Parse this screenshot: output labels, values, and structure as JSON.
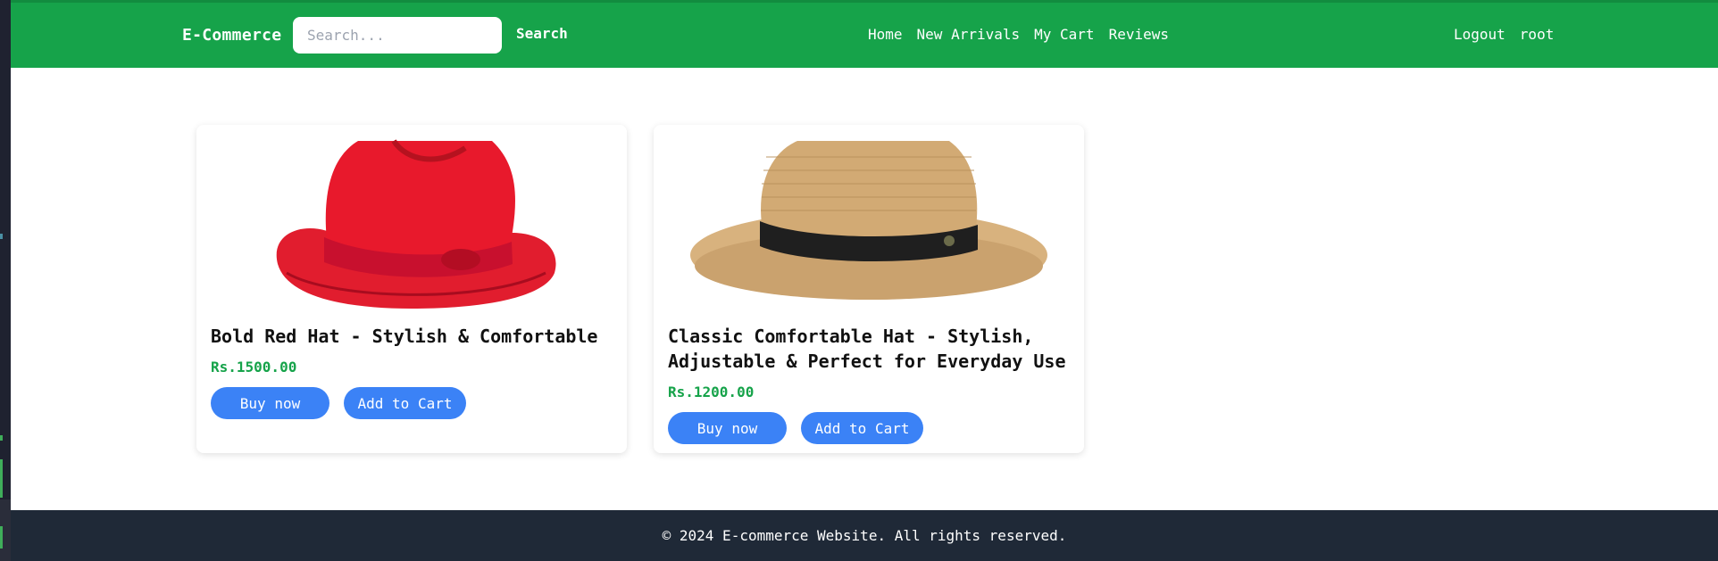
{
  "navbar": {
    "brand": "E-Commerce",
    "search_placeholder": "Search...",
    "search_label": "Search",
    "links": [
      "Home",
      "New Arrivals",
      "My Cart",
      "Reviews"
    ],
    "logout_label": "Logout",
    "username": "root"
  },
  "products": [
    {
      "title": "Bold Red Hat - Stylish & Comfortable",
      "price": "Rs.1500.00",
      "buy_label": "Buy now",
      "cart_label": "Add to Cart",
      "image_icon": "red-fedora-hat"
    },
    {
      "title": "Classic Comfortable Hat - Stylish, Adjustable & Perfect for Everyday Use",
      "price": "Rs.1200.00",
      "buy_label": "Buy now",
      "cart_label": "Add to Cart",
      "image_icon": "straw-panama-hat"
    }
  ],
  "footer": {
    "text": "© 2024 E-commerce Website. All rights reserved."
  },
  "colors": {
    "navbar": "#16a34a",
    "price": "#16a34a",
    "button": "#3b82f6",
    "footer": "#1f2937"
  }
}
